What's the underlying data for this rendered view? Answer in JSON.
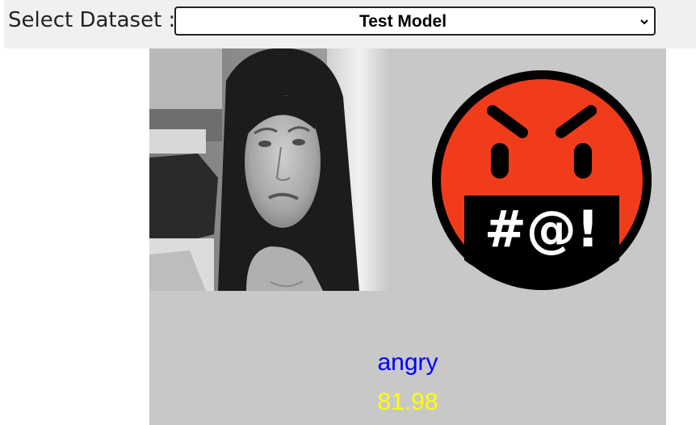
{
  "header": {
    "select_label": "Select Dataset :",
    "dataset_select": {
      "selected": "Test Model"
    }
  },
  "result": {
    "photo_description_icon": "face-photo",
    "emoji_icon": "angry-face-emoji",
    "emoji_text": "#@!",
    "emotion": "angry",
    "score": "81.98",
    "colors": {
      "emotion_text": "#0000ff",
      "score_text": "#ffff00",
      "emoji_face": "#f03c1a",
      "panel_bg": "#c8c8c8"
    }
  }
}
